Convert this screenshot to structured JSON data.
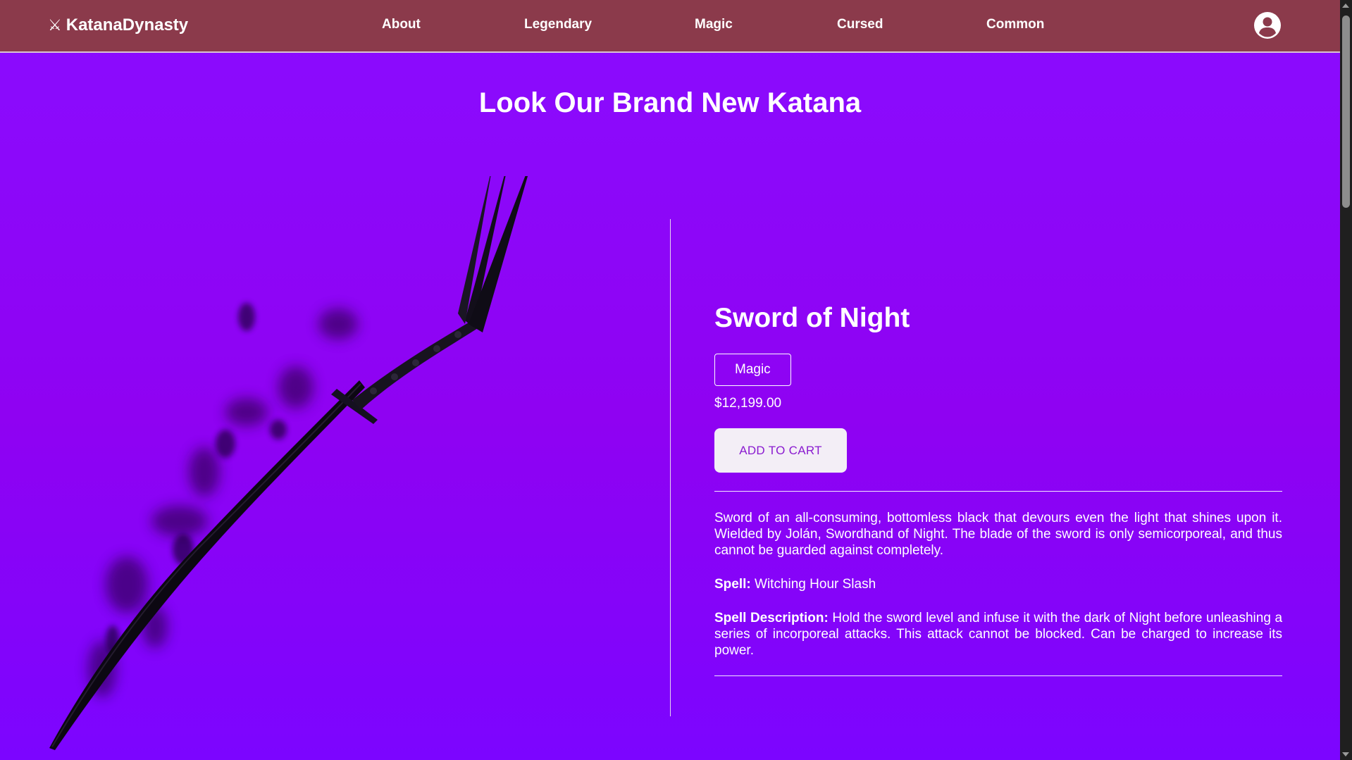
{
  "navbar": {
    "brand_icon": "⚔",
    "brand_name": "KatanaDynasty",
    "links": [
      "About",
      "Legendary",
      "Magic",
      "Cursed",
      "Common"
    ],
    "avatar_icon": "user-account-icon",
    "background": "#8b3a4b"
  },
  "hero": {
    "title": "Look Our Brand New Katana"
  },
  "product": {
    "image_icon": "black-katana-image",
    "name": "Sword of Night",
    "category": "Magic",
    "price": "$12,199.00",
    "add_to_cart": "ADD TO CART",
    "description": "Sword of an all-consuming, bottomless black that devours even the light that shines upon it. Wielded by Jolán, Swordhand of Night. The blade of the sword is only semicorporeal, and thus cannot be guarded against completely.",
    "spell_label": "Spell:",
    "spell": "Witching Hour Slash",
    "spell_description_label": "Spell Description:",
    "spell_description": "Hold the sword level and infuse it with the dark of Night before unleashing a series of incorporeal attacks. This attack cannot be blocked. Can be charged to increase its power."
  },
  "colors": {
    "page_background": "#8b00ff",
    "button_text": "#8a1ad0",
    "button_background": "#f3eef6"
  }
}
